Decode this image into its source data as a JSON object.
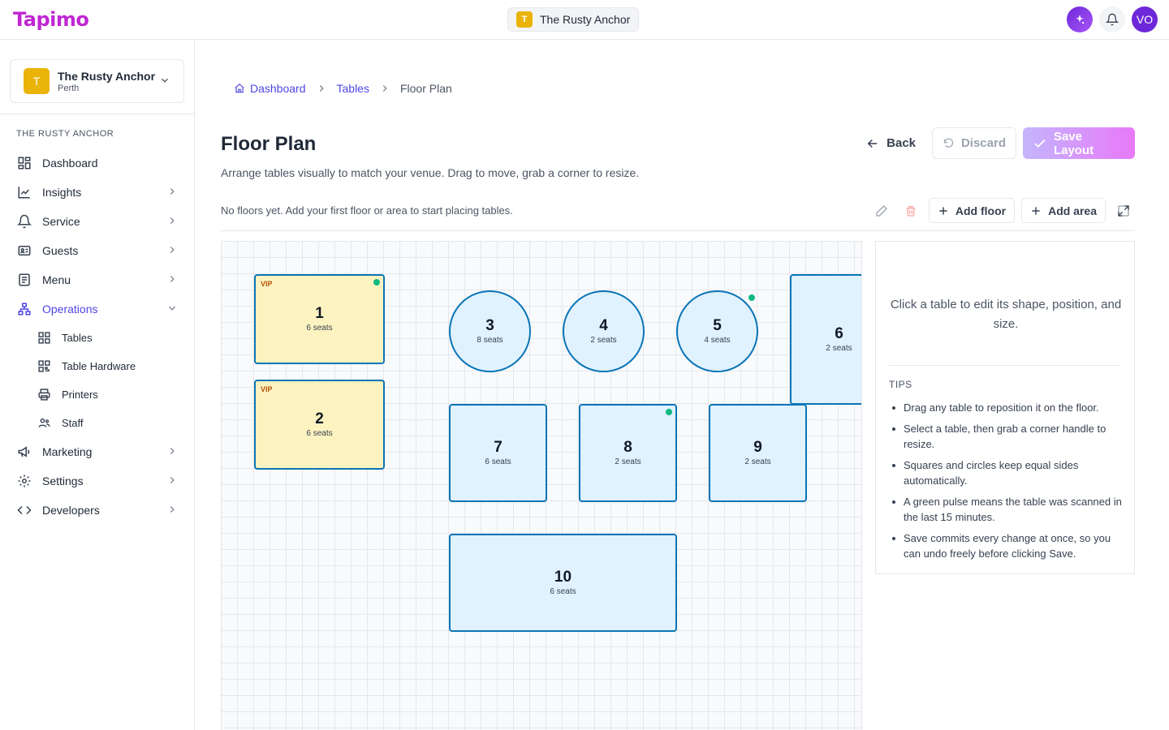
{
  "app": {
    "logo": "Tapimo"
  },
  "header": {
    "venue_initial": "T",
    "venue_name": "The Rusty Anchor",
    "avatar_initials": "VO"
  },
  "sidebar": {
    "venue": {
      "initial": "T",
      "name": "The Rusty Anchor",
      "city": "Perth"
    },
    "section_label": "THE RUSTY ANCHOR",
    "items": [
      {
        "label": "Dashboard"
      },
      {
        "label": "Insights"
      },
      {
        "label": "Service"
      },
      {
        "label": "Guests"
      },
      {
        "label": "Menu"
      },
      {
        "label": "Operations"
      },
      {
        "label": "Marketing"
      },
      {
        "label": "Settings"
      },
      {
        "label": "Developers"
      }
    ],
    "operations_sub": [
      {
        "label": "Tables"
      },
      {
        "label": "Table Hardware"
      },
      {
        "label": "Printers"
      },
      {
        "label": "Staff"
      }
    ]
  },
  "breadcrumb": {
    "home": "Dashboard",
    "parent": "Tables",
    "current": "Floor Plan"
  },
  "page": {
    "title": "Floor Plan",
    "subtitle": "Arrange tables visually to match your venue. Drag to move, grab a corner to resize.",
    "no_floors": "No floors yet. Add your first floor or area to start placing tables."
  },
  "actions": {
    "back": "Back",
    "discard": "Discard",
    "save": "Save Layout",
    "add_floor": "Add floor",
    "add_area": "Add area"
  },
  "tables": [
    {
      "number": "1",
      "seats": "6 seats",
      "vip": "VIP",
      "scanned": true
    },
    {
      "number": "2",
      "seats": "6 seats",
      "vip": "VIP",
      "scanned": false
    },
    {
      "number": "3",
      "seats": "8 seats",
      "scanned": false
    },
    {
      "number": "4",
      "seats": "2 seats",
      "scanned": false
    },
    {
      "number": "5",
      "seats": "4 seats",
      "scanned": true
    },
    {
      "number": "6",
      "seats": "2 seats",
      "scanned": false
    },
    {
      "number": "7",
      "seats": "6 seats",
      "scanned": false
    },
    {
      "number": "8",
      "seats": "2 seats",
      "scanned": true
    },
    {
      "number": "9",
      "seats": "2 seats",
      "scanned": false
    },
    {
      "number": "10",
      "seats": "6 seats",
      "scanned": false
    }
  ],
  "panel": {
    "hint": "Click a table to edit its shape, position, and size.",
    "tips_label": "TIPS",
    "tips": [
      "Drag any table to reposition it on the floor.",
      "Select a table, then grab a corner handle to resize.",
      "Squares and circles keep equal sides automatically.",
      "A green pulse means the table was scanned in the last 15 minutes.",
      "Save commits every change at once, so you can undo freely before clicking Save."
    ]
  },
  "colors": {
    "accent": "#4f46e5",
    "table_fill": "#e0f2fe",
    "vip_fill": "#fdf3c0",
    "table_border": "#0b75b6",
    "pulse": "#10b981"
  }
}
